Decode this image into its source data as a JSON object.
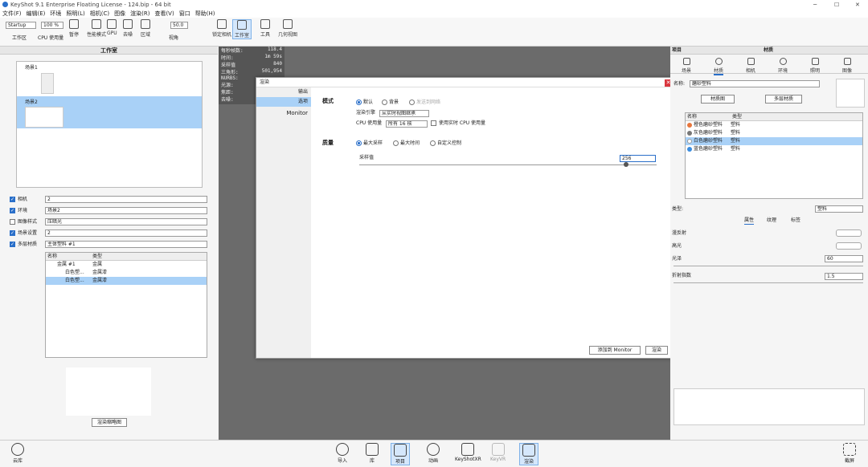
{
  "window": {
    "title": "KeyShot 9.1 Enterprise Floating License - 124.bip - 64 bit"
  },
  "menu": [
    "文件(F)",
    "编辑(E)",
    "环境",
    "照明(L)",
    "相机(C)",
    "图像",
    "渲染(R)",
    "查看(V)",
    "窗口",
    "帮助(H)"
  ],
  "toolbar": {
    "startup": "Startup",
    "percent": "100 %",
    "fov": "50.0",
    "items": [
      "工作区",
      "CPU 使用量",
      "暂停",
      "性能模式",
      "GPU",
      "去噪",
      "区域",
      "视角",
      "锁定相机",
      "工作室",
      "工具",
      "几何视图"
    ]
  },
  "left": {
    "header": "工作室",
    "scenes": [
      "场景1",
      "场景2"
    ],
    "props": [
      {
        "label": "相机",
        "value": "2",
        "checked": true
      },
      {
        "label": "环境",
        "value": "场景2",
        "checked": true
      },
      {
        "label": "图像样式",
        "value": "压暗光",
        "checked": false
      },
      {
        "label": "场景设置",
        "value": "2",
        "checked": true
      },
      {
        "label": "多层材质",
        "value": "主体塑料 #1",
        "checked": true
      }
    ],
    "table_headers": [
      "名称",
      "类型"
    ],
    "table_rows": [
      [
        "金属 #1",
        "金属"
      ],
      [
        "白色塑...",
        "金属漆"
      ],
      [
        "白色塑...",
        "金属漆"
      ]
    ],
    "thumb_button": "渲染缩略图"
  },
  "hud": [
    "每秒帧数:",
    "时间:",
    "采样值",
    "三角形:",
    "NURBS:",
    "光源:",
    "焦距:",
    "去噪:"
  ],
  "hud_values": [
    "118.4",
    "1m 59s",
    "840",
    "501,954",
    "",
    "",
    "",
    ""
  ],
  "dialog": {
    "title": "渲染",
    "tabs": [
      "输出",
      "选项",
      "Monitor"
    ],
    "mode_label": "模式",
    "modes": [
      "默认",
      "背景",
      "发送到网络"
    ],
    "engine_label": "渲染引擎",
    "engine_value": "从实时视图继承",
    "cpu_label": "CPU 使用量",
    "cpu_value": "所有 16 核",
    "realtime_label": "使用实时 CPU 使用量",
    "quality_label": "质量",
    "qualities": [
      "最大采样",
      "最大时间",
      "自定义控制"
    ],
    "samples_label": "采样值",
    "samples_value": "256",
    "add_monitor": "添加到 Monitor",
    "render": "渲染"
  },
  "right": {
    "header_left": "项目",
    "header_center": "材质",
    "tabs": [
      "场景",
      "材质",
      "相机",
      "环境",
      "照明",
      "图像"
    ],
    "name_label": "名称:",
    "name_value": "磨砂塑料",
    "buttons": [
      "材质图",
      "多层材质"
    ],
    "table_headers": [
      "名称",
      "类型"
    ],
    "materials": [
      {
        "name": "橙色磨砂塑料",
        "type": "塑料",
        "color": "#e8763c"
      },
      {
        "name": "灰色磨砂塑料",
        "type": "塑料",
        "color": "#777777"
      },
      {
        "name": "白色磨砂塑料",
        "type": "塑料",
        "color": "#ffffff"
      },
      {
        "name": "蓝色磨砂塑料",
        "type": "塑料",
        "color": "#3a8de0"
      }
    ],
    "type_label": "类型:",
    "type_value": "塑料",
    "subtabs": [
      "属性",
      "纹理",
      "标签"
    ],
    "params": [
      {
        "label": "漫反射",
        "value": ""
      },
      {
        "label": "高光",
        "value": ""
      },
      {
        "label": "光泽",
        "value": "60"
      },
      {
        "label": "折射指数",
        "value": "1.5"
      }
    ]
  },
  "bottom": {
    "left": "云库",
    "right": "截屏",
    "items": [
      "导入",
      "库",
      "项目",
      "动画",
      "KeyShotXR",
      "KeyVR",
      "渲染"
    ]
  }
}
